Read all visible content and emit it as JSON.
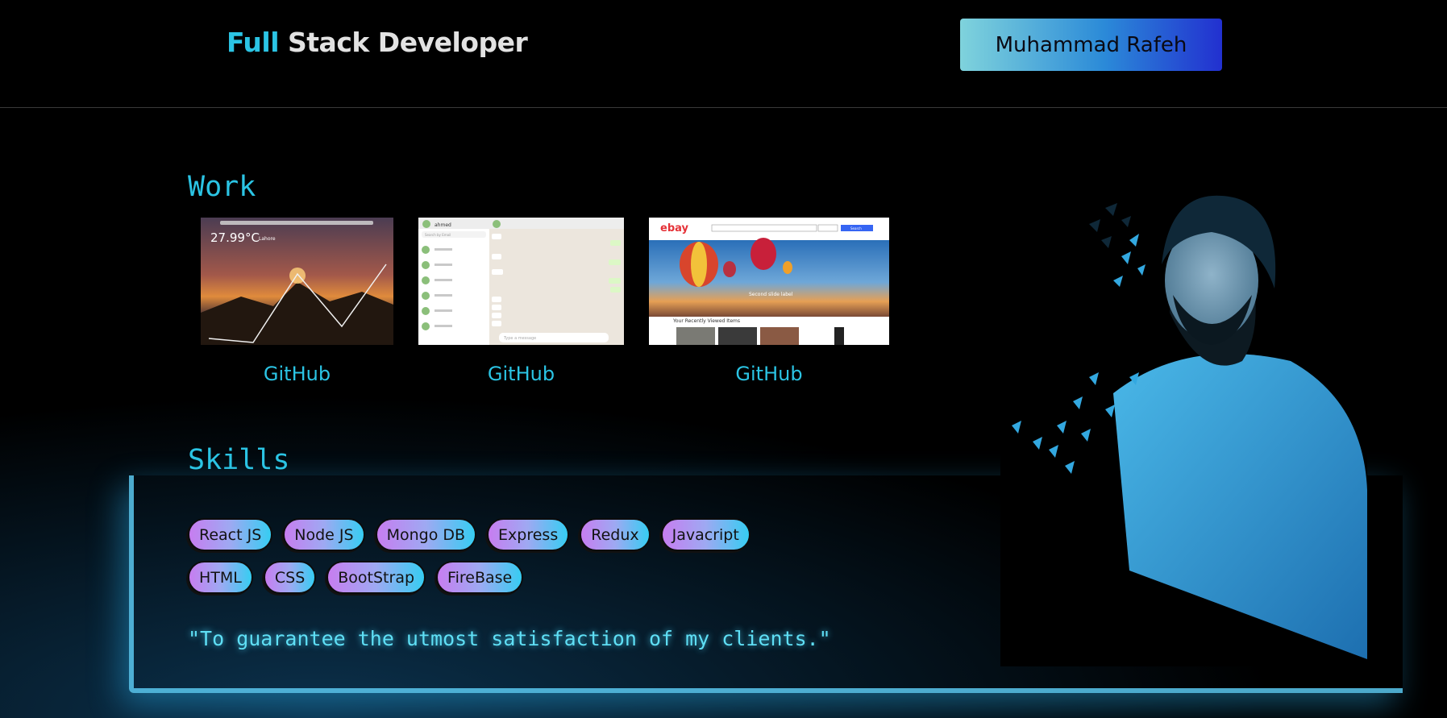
{
  "header": {
    "brand_accent": "Full",
    "brand_rest": " Stack Developer",
    "name_button": "Muhammad Rafeh"
  },
  "work": {
    "title": "Work",
    "projects": [
      {
        "link": "GitHub",
        "temperature": "27.99°C",
        "city": "Lahore"
      },
      {
        "link": "GitHub",
        "chat_user": "ahmed",
        "search_placeholder": "Search by Email",
        "message_placeholder": "Type a message"
      },
      {
        "link": "GitHub",
        "brand": "ebay",
        "banner": "Second slide label",
        "section": "Your Recently Viewed Items",
        "search_button": "Search"
      }
    ]
  },
  "skills": {
    "title": "Skills",
    "row1": [
      "React JS",
      "Node JS",
      "Mongo DB",
      "Express",
      "Redux",
      "Javacript"
    ],
    "row2": [
      "HTML",
      "CSS",
      "BootStrap",
      "FireBase"
    ]
  },
  "quote": "\"To guarantee the utmost satisfaction of my clients.\"",
  "colors": {
    "accent": "#2bc4e4",
    "button_gradient": [
      "#7fd3dc",
      "#2b8ad8",
      "#2230d0"
    ],
    "pill_gradient": [
      "#c77df0",
      "#9ea9f2",
      "#36cdf2"
    ]
  }
}
